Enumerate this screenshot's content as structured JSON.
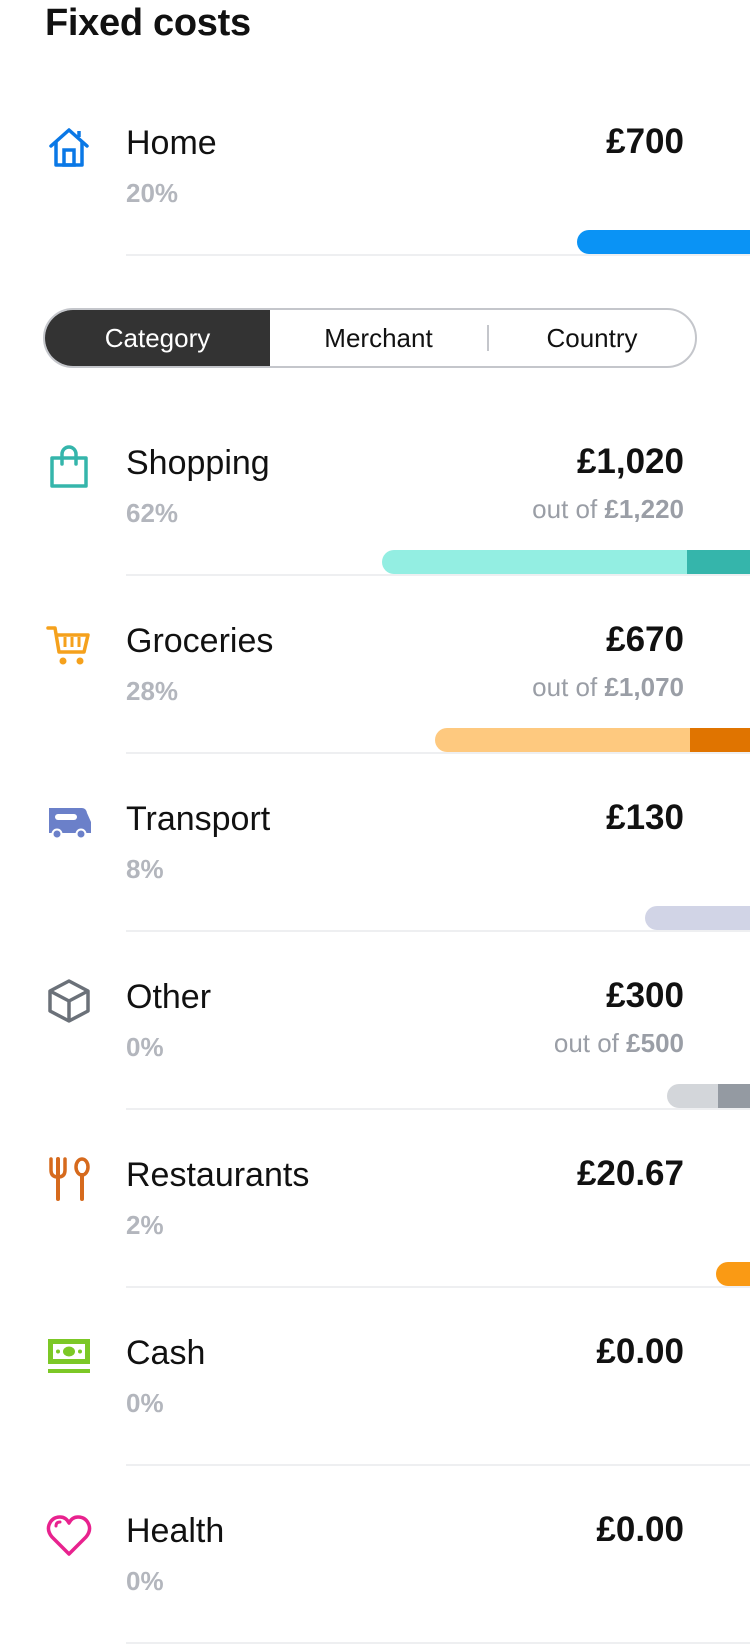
{
  "fixed_costs": {
    "title": "Fixed costs",
    "items": [
      {
        "name": "Home",
        "percent": "20%",
        "amount": "£700",
        "icon": "home-icon",
        "bar_fraction": 0.23,
        "bar_colors": [
          "#0a93f5"
        ]
      }
    ]
  },
  "segmented_control": {
    "options": [
      "Category",
      "Merchant",
      "Country"
    ],
    "selected": "Category"
  },
  "categories": [
    {
      "name": "Shopping",
      "percent": "62%",
      "amount": "£1,020",
      "budget_prefix": "out of",
      "budget": "£1,220",
      "icon": "shopping-bag-icon",
      "color": "#35b5ab",
      "bar_fraction": 0.49,
      "bar_colors": [
        "#93eee2",
        "#35b5ab"
      ],
      "bar_split": 0.83
    },
    {
      "name": "Groceries",
      "percent": "28%",
      "amount": "£670",
      "budget_prefix": "out of",
      "budget": "£1,070",
      "icon": "shopping-cart-icon",
      "color": "#f5a11c",
      "bar_fraction": 0.42,
      "bar_colors": [
        "#fec97f",
        "#e07400"
      ],
      "bar_split": 0.81
    },
    {
      "name": "Transport",
      "percent": "8%",
      "amount": "£130",
      "icon": "bus-icon",
      "color": "#6b80c9",
      "bar_fraction": 0.14,
      "bar_colors": [
        "#d1d4e6"
      ]
    },
    {
      "name": "Other",
      "percent": "0%",
      "amount": "£300",
      "budget_prefix": "out of",
      "budget": "£500",
      "icon": "box-icon",
      "color": "#6b7179",
      "bar_fraction": 0.11,
      "bar_colors": [
        "#d3d6da",
        "#949aa2"
      ],
      "bar_split": 0.62
    },
    {
      "name": "Restaurants",
      "percent": "2%",
      "amount": "£20.67",
      "icon": "cutlery-icon",
      "color": "#d66a1d",
      "bar_fraction": 0.045,
      "bar_colors": [
        "#fa9a14"
      ]
    },
    {
      "name": "Cash",
      "percent": "0%",
      "amount": "£0.00",
      "icon": "cash-icon",
      "color": "#7cc826",
      "bar_fraction": 0,
      "bar_colors": []
    },
    {
      "name": "Health",
      "percent": "0%",
      "amount": "£0.00",
      "icon": "heart-icon",
      "color": "#e8228e",
      "bar_fraction": 0,
      "bar_colors": []
    }
  ]
}
